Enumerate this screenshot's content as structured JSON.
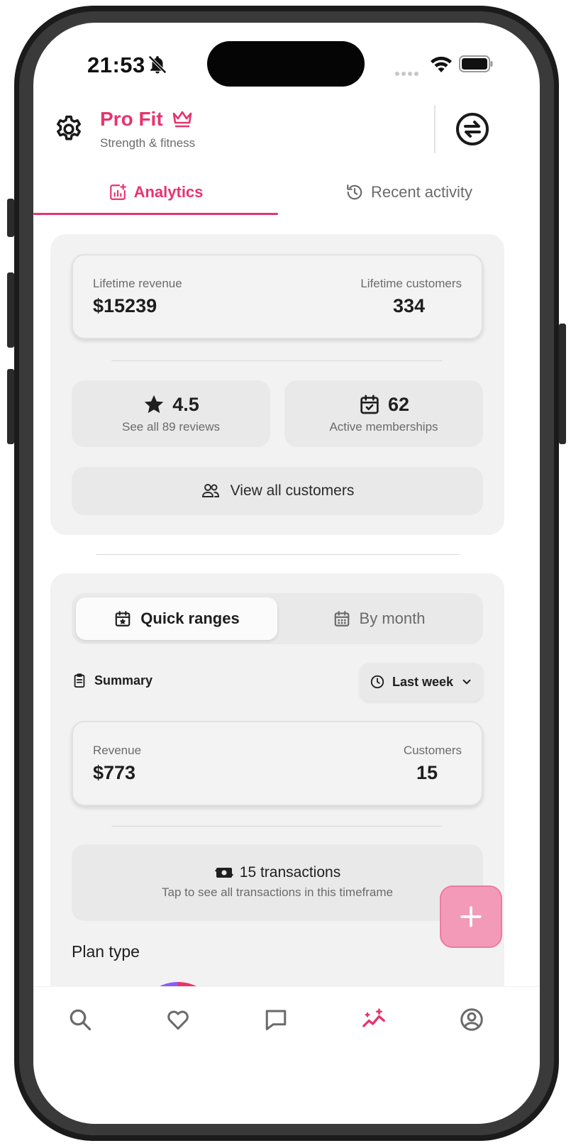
{
  "status_bar": {
    "time": "21:53",
    "icons": [
      "bell-slash-icon",
      "signal-icon",
      "wifi-icon",
      "battery-icon"
    ]
  },
  "header": {
    "brand": "Pro Fit",
    "subtitle": "Strength & fitness",
    "icons": [
      "gear-icon",
      "crown-icon",
      "swap-icon"
    ]
  },
  "tabs": [
    {
      "label": "Analytics",
      "icon": "analytics-icon",
      "active": true
    },
    {
      "label": "Recent activity",
      "icon": "history-icon",
      "active": false
    }
  ],
  "lifetime": {
    "revenue_label": "Lifetime revenue",
    "revenue_value": "$15239",
    "customers_label": "Lifetime customers",
    "customers_value": "334"
  },
  "reviews": {
    "rating": "4.5",
    "sub": "See all 89 reviews"
  },
  "memberships": {
    "count": "62",
    "sub": "Active memberships"
  },
  "customers_button": {
    "label": "View all customers"
  },
  "range_tabs": {
    "quick_label": "Quick ranges",
    "month_label": "By month"
  },
  "summary": {
    "label": "Summary",
    "range_selected": "Last week"
  },
  "period": {
    "revenue_label": "Revenue",
    "revenue_value": "$773",
    "customers_label": "Customers",
    "customers_value": "15"
  },
  "transactions": {
    "title": "15 transactions",
    "sub": "Tap to see all transactions in this timeframe"
  },
  "plan_type": {
    "title": "Plan type"
  },
  "colors": {
    "accent": "#e8336e",
    "fab": "#f39ab8",
    "card": "#f2f2f2",
    "tile": "#e9e9e9"
  },
  "bottom_nav": [
    "search-icon",
    "heart-icon",
    "chat-icon",
    "analytics-sparkle-icon",
    "profile-icon"
  ]
}
